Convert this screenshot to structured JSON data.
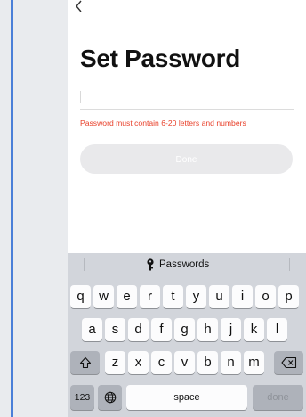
{
  "screen": {
    "back_glyph": "‹",
    "title": "Set Password",
    "password_input": {
      "value": "",
      "placeholder": ""
    },
    "error_message": "Password must contain 6-20 letters and numbers",
    "done_button": "Done"
  },
  "keyboard": {
    "suggestion": "Passwords",
    "row1": [
      "q",
      "w",
      "e",
      "r",
      "t",
      "y",
      "u",
      "i",
      "o",
      "p"
    ],
    "row2": [
      "a",
      "s",
      "d",
      "f",
      "g",
      "h",
      "j",
      "k",
      "l"
    ],
    "row3": [
      "z",
      "x",
      "c",
      "v",
      "b",
      "n",
      "m"
    ],
    "bottom": {
      "numbers": "123",
      "space": "space",
      "done": "done"
    }
  },
  "colors": {
    "accent_left_rule": "#4a7fd8",
    "error_text": "#e8402a",
    "button_disabled": "#e9e9eb",
    "keyboard_bg": "#d2d5db"
  },
  "icons": [
    "chevron-left-icon",
    "key-icon",
    "shift-icon",
    "backspace-icon",
    "globe-icon"
  ]
}
